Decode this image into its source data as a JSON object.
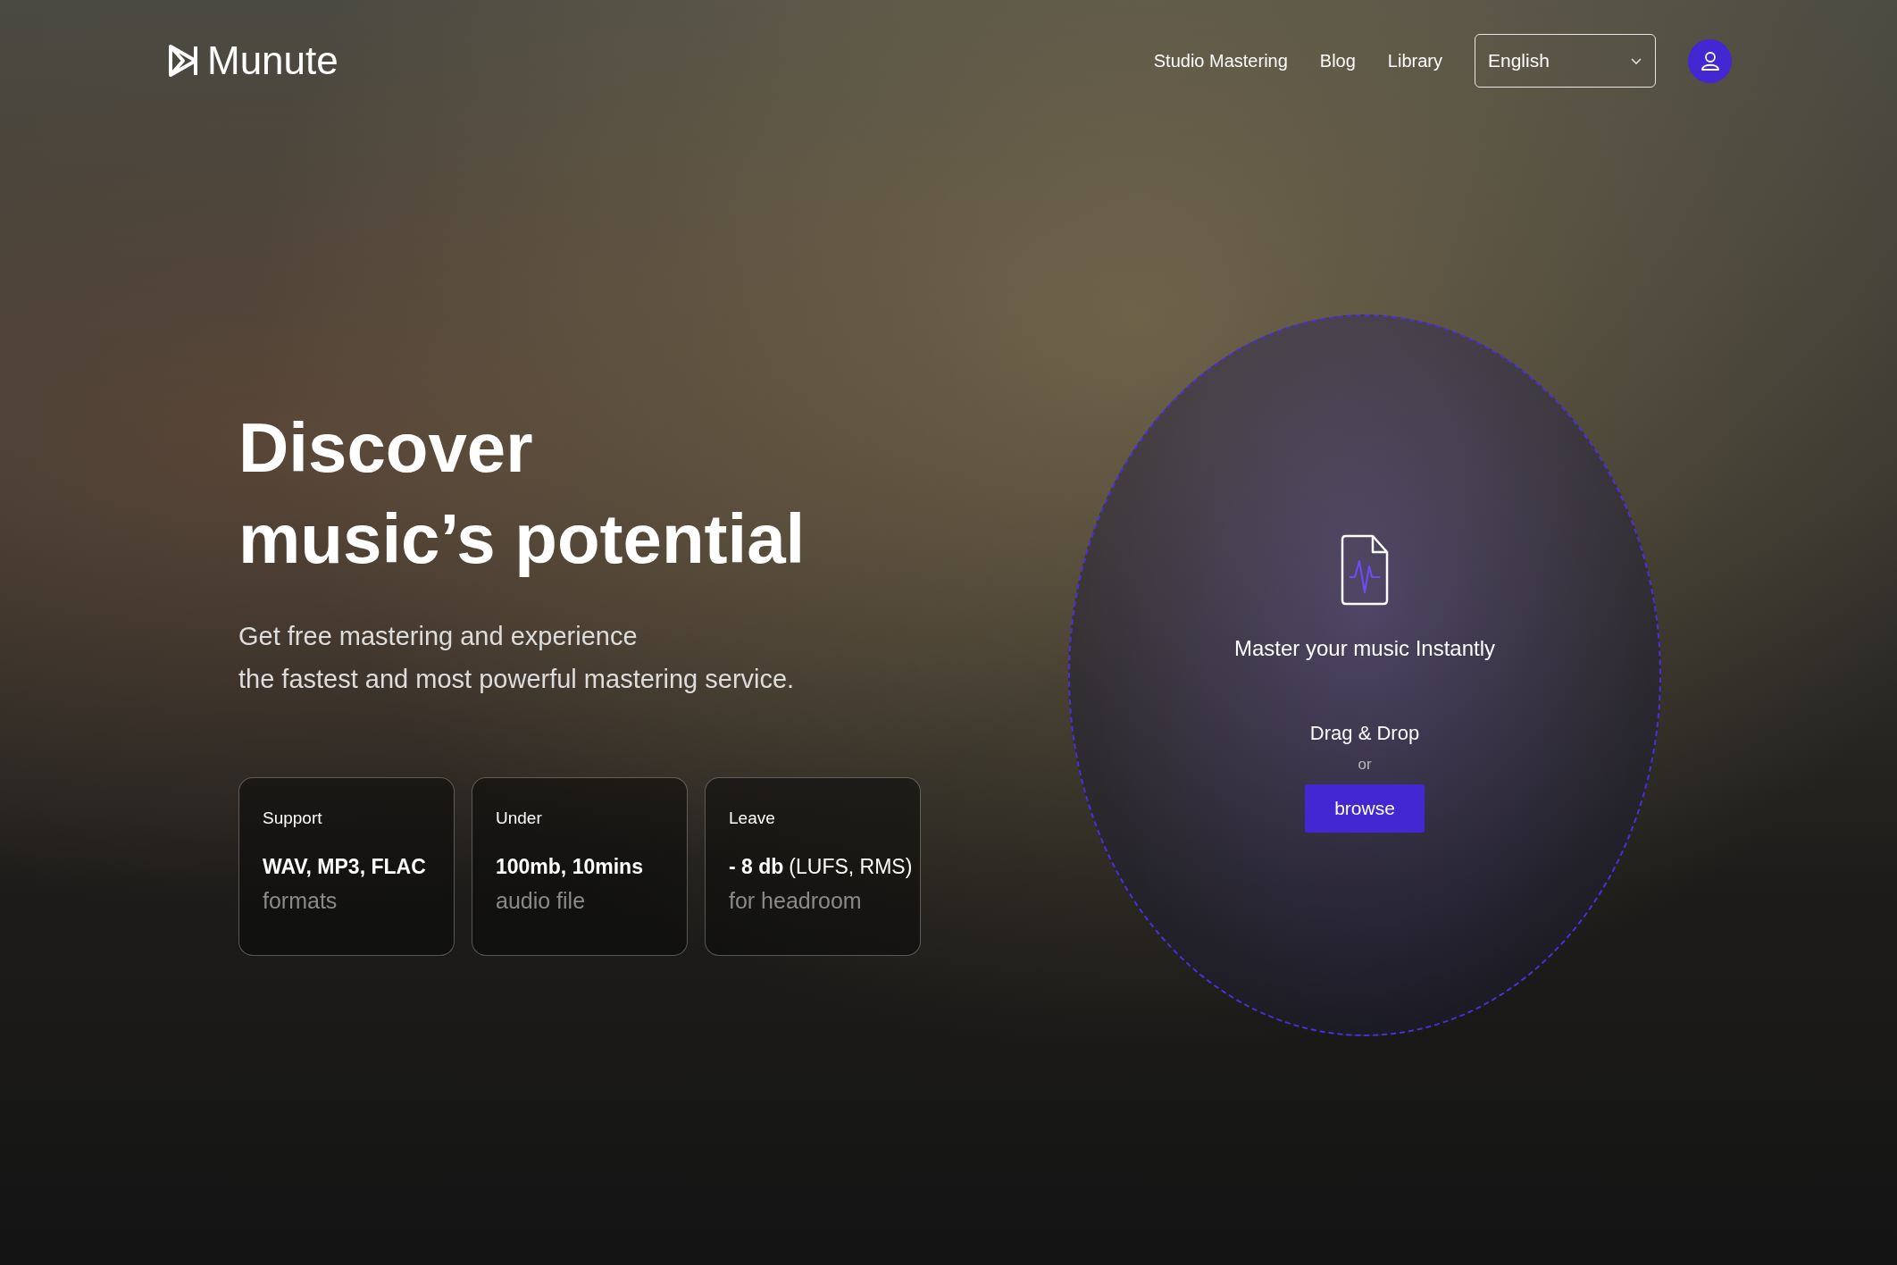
{
  "header": {
    "logo": "Munute",
    "nav": [
      "Studio Mastering",
      "Blog",
      "Library"
    ],
    "language": {
      "value": "English"
    }
  },
  "hero": {
    "title_lines": [
      "Discover",
      "music’s potential"
    ],
    "subtitle_lines": [
      "Get free mastering and experience",
      "the fastest and most powerful mastering service."
    ]
  },
  "cards": [
    {
      "label": "Support",
      "value": "WAV, MP3, FLAC",
      "caption": "formats"
    },
    {
      "label": "Under",
      "value": "100mb, 10mins",
      "caption": "audio file"
    },
    {
      "label": "Leave",
      "value": "- 8 db",
      "note": "(LUFS, RMS)",
      "caption": "for headroom"
    }
  ],
  "upload": {
    "title": "Master your music Instantly",
    "drag": "Drag & Drop",
    "or": "or",
    "button": "browse"
  }
}
